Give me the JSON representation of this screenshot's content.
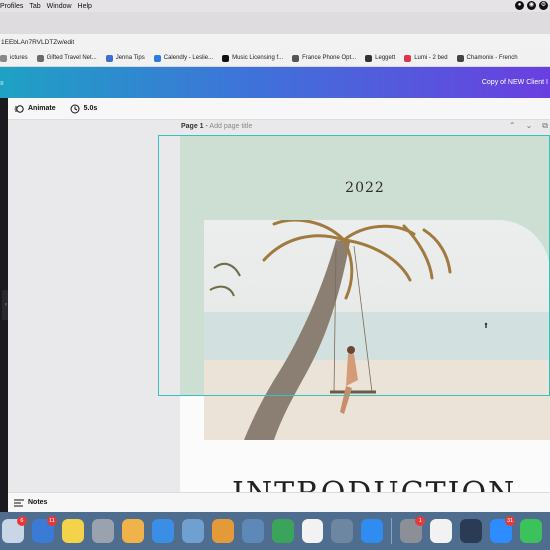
{
  "menubar": {
    "items": [
      "Profiles",
      "Tab",
      "Window",
      "Help"
    ]
  },
  "browser": {
    "url": "1EEbLAn7RVLDTZw/edit",
    "bookmarks": [
      {
        "label": "ictures",
        "color": "#888888"
      },
      {
        "label": "Gifted Travel Net...",
        "color": "#6b6b6b"
      },
      {
        "label": "Jenna Tips",
        "color": "#3b6fd6"
      },
      {
        "label": "Calendly - Leslie...",
        "color": "#2a7be4"
      },
      {
        "label": "Music Licensing f...",
        "color": "#111111"
      },
      {
        "label": "France Phone Opt...",
        "color": "#555555"
      },
      {
        "label": "Leggett",
        "color": "#333333"
      },
      {
        "label": "Lumi - 2 bed",
        "color": "#e0344a"
      },
      {
        "label": "Chamonix - French",
        "color": "#444444"
      }
    ]
  },
  "canva": {
    "doc_title": "Copy of NEW Client I",
    "toolbar": {
      "animate_label": "Animate",
      "duration_label": "5.0s"
    },
    "page": {
      "page_number": "Page 1",
      "separator": " - ",
      "add_title": "Add page title",
      "year": "2022",
      "headline": "INTRODUCTION"
    },
    "notes_label": "Notes",
    "side_handle": "‹"
  },
  "dock": {
    "apps": [
      {
        "name": "mail",
        "color": "#c9d6e6",
        "badge": "6"
      },
      {
        "name": "photos-app",
        "color": "#3a7bd5",
        "badge": "11"
      },
      {
        "name": "notes",
        "color": "#f3d34a",
        "badge": ""
      },
      {
        "name": "launchpad",
        "color": "#9aa3ad",
        "badge": ""
      },
      {
        "name": "photos",
        "color": "#f0b34a",
        "badge": ""
      },
      {
        "name": "messages-chat",
        "color": "#3a8ee6",
        "badge": ""
      },
      {
        "name": "preview",
        "color": "#6fa0cf",
        "badge": ""
      },
      {
        "name": "pages",
        "color": "#e59a3a",
        "badge": ""
      },
      {
        "name": "image-capture",
        "color": "#5e88b8",
        "badge": ""
      },
      {
        "name": "numbers",
        "color": "#3aa55a",
        "badge": ""
      },
      {
        "name": "music",
        "color": "#f2f2f2",
        "badge": ""
      },
      {
        "name": "help",
        "color": "#6d87a3",
        "badge": ""
      },
      {
        "name": "app-store",
        "color": "#2f8cf0",
        "badge": ""
      },
      {
        "name": "system-preferences",
        "color": "#8b8f96",
        "badge": "1"
      },
      {
        "name": "chrome",
        "color": "#f2f2f2",
        "badge": ""
      },
      {
        "name": "quicktime",
        "color": "#2c3b55",
        "badge": ""
      },
      {
        "name": "zoom",
        "color": "#2d8cff",
        "badge": "31"
      },
      {
        "name": "facetime",
        "color": "#3bc25a",
        "badge": ""
      }
    ]
  }
}
